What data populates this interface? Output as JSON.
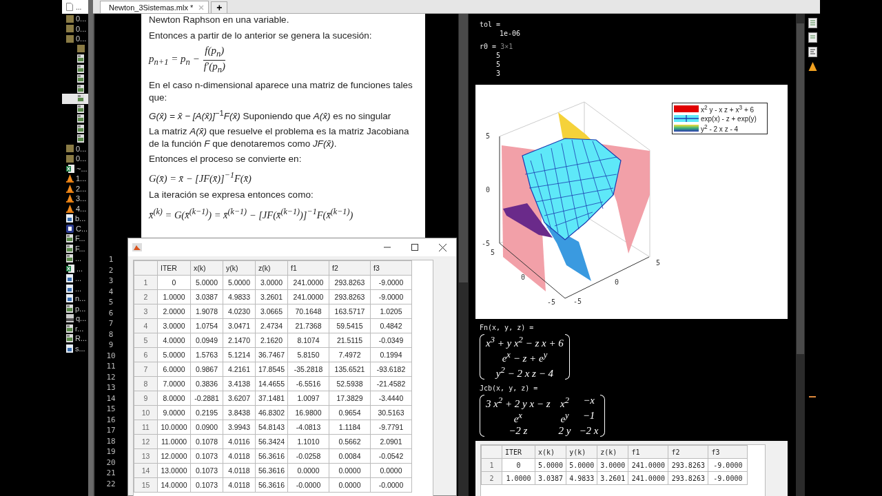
{
  "file_browser": {
    "header": "...",
    "items": [
      {
        "kind": "folder",
        "label": "0...",
        "selected": false
      },
      {
        "kind": "folder",
        "label": "0...",
        "selected": false
      },
      {
        "kind": "folder",
        "label": "0...",
        "selected": false,
        "children": [
          {
            "kind": "folder",
            "selected": false
          },
          {
            "kind": "live",
            "selected": false
          },
          {
            "kind": "live",
            "selected": false
          },
          {
            "kind": "live",
            "selected": false
          },
          {
            "kind": "live",
            "selected": false
          },
          {
            "kind": "live",
            "selected": true
          },
          {
            "kind": "live",
            "selected": false
          },
          {
            "kind": "live",
            "selected": false
          },
          {
            "kind": "live",
            "selected": false
          },
          {
            "kind": "live",
            "selected": false
          }
        ]
      },
      {
        "kind": "folder",
        "label": "0...",
        "selected": false
      },
      {
        "kind": "folder",
        "label": "0...",
        "selected": false
      },
      {
        "kind": "sheet",
        "label": "~...",
        "selected": false
      },
      {
        "kind": "cone",
        "label": "1...",
        "selected": false
      },
      {
        "kind": "cone",
        "label": "2...",
        "selected": false
      },
      {
        "kind": "cone",
        "label": "3...",
        "selected": false
      },
      {
        "kind": "cone",
        "label": "4...",
        "selected": false
      },
      {
        "kind": "image",
        "label": "b...",
        "selected": false
      },
      {
        "kind": "app",
        "label": "C...",
        "selected": false
      },
      {
        "kind": "live",
        "label": "F...",
        "selected": false
      },
      {
        "kind": "live",
        "label": "F...",
        "selected": false
      },
      {
        "kind": "live",
        "label": "...",
        "selected": false
      },
      {
        "kind": "sheet",
        "label": "...",
        "selected": false
      },
      {
        "kind": "image",
        "label": "...",
        "selected": false
      },
      {
        "kind": "image",
        "label": "...",
        "selected": false
      },
      {
        "kind": "image",
        "label": "n...",
        "selected": false
      },
      {
        "kind": "live",
        "label": "p...",
        "selected": false
      },
      {
        "kind": "ps",
        "label": "q...",
        "selected": false
      },
      {
        "kind": "live",
        "label": "r...",
        "selected": false
      },
      {
        "kind": "live",
        "label": "R...",
        "selected": false
      },
      {
        "kind": "image",
        "label": "s...",
        "selected": false
      }
    ]
  },
  "tabs": [
    {
      "label": "Newton_3Sistemas.mlx *",
      "selected": true
    }
  ],
  "new_tab": "+",
  "document": [
    {
      "kind": "text",
      "text": "Newton Raphson en una variable."
    },
    {
      "kind": "text",
      "text": "Entonces a partir de lo anterior se genera la sucesión:"
    },
    {
      "kind": "fraction",
      "lhs": "p$_{n+1}$ = p$_{n}$ −",
      "numerator": "f(p$_{n}$)",
      "denominator": "f′(p$_{n}$)"
    },
    {
      "kind": "text",
      "text": "En el caso n-dimensional aparece una matriz de funciones tales que:"
    },
    {
      "kind": "text",
      "text": "*G(x̄) = x̄ − [A(x̄)]*$^{−1}$*F(x̄)* Suponiendo que *A(x̄)* es no singular"
    },
    {
      "kind": "text",
      "text": "La matriz *A(x̄)* que resuelve el problema es la matriz Jacobiana de la función *F* que denotaremos como *JF(x̄)*."
    },
    {
      "kind": "text",
      "text": "Entonces el proceso se convierte en:"
    },
    {
      "kind": "math",
      "text": "G(x̄) = x̄ − [JF(x̄)]$^{−1}$F(x̄)"
    },
    {
      "kind": "text",
      "text": "La iteración se expresa entonces como:"
    },
    {
      "kind": "math",
      "text": "x̄$^{(k)}$ = G(x̄$^{(k−1)}$) = x̄$^{(k−1)}$ − [JF(x̄$^{(k−1)}$)]$^{−1}$F(x̄$^{(k−1)}$)"
    }
  ],
  "line_numbers": [
    "1",
    "2",
    "3",
    "4",
    "5",
    "6",
    "7",
    "8",
    "9",
    "10",
    "11",
    "12",
    "13",
    "14",
    "15",
    "16",
    "17",
    "18",
    "19",
    "20",
    "21",
    "22"
  ],
  "figure_window": {
    "table": {
      "columns": [
        "",
        "ITER",
        "x(k)",
        "y(k)",
        "z(k)",
        "f1",
        "f2",
        "f3"
      ],
      "rows": [
        [
          "1",
          "0",
          "5.0000",
          "5.0000",
          "3.0000",
          "241.0000",
          "293.8263",
          "-9.0000"
        ],
        [
          "2",
          "1.0000",
          "3.0387",
          "4.9833",
          "3.2601",
          "241.0000",
          "293.8263",
          "-9.0000"
        ],
        [
          "3",
          "2.0000",
          "1.9078",
          "4.0230",
          "3.0665",
          "70.1648",
          "163.5717",
          "1.0205"
        ],
        [
          "4",
          "3.0000",
          "1.0754",
          "3.0471",
          "2.4734",
          "21.7368",
          "59.5415",
          "0.4842"
        ],
        [
          "5",
          "4.0000",
          "0.0949",
          "2.1470",
          "2.1620",
          "8.1074",
          "21.5115",
          "-0.0349"
        ],
        [
          "6",
          "5.0000",
          "1.5763",
          "5.1214",
          "36.7467",
          "5.8150",
          "7.4972",
          "0.1994"
        ],
        [
          "7",
          "6.0000",
          "0.9867",
          "4.2161",
          "17.8545",
          "-35.2818",
          "135.6521",
          "-93.6182"
        ],
        [
          "8",
          "7.0000",
          "0.3836",
          "3.4138",
          "14.4655",
          "-6.5516",
          "52.5938",
          "-21.4582"
        ],
        [
          "9",
          "8.0000",
          "-0.2881",
          "3.6207",
          "37.1481",
          "1.0097",
          "17.3829",
          "-3.4440"
        ],
        [
          "10",
          "9.0000",
          "0.2195",
          "3.8438",
          "46.8302",
          "16.9800",
          "0.9654",
          "30.5163"
        ],
        [
          "11",
          "10.0000",
          "0.0900",
          "3.9943",
          "54.8143",
          "-4.0813",
          "1.1184",
          "-9.7791"
        ],
        [
          "12",
          "11.0000",
          "0.1078",
          "4.0116",
          "56.3424",
          "1.1010",
          "0.5662",
          "2.0901"
        ],
        [
          "13",
          "12.0000",
          "0.1073",
          "4.0118",
          "56.3616",
          "-0.0258",
          "0.0084",
          "-0.0542"
        ],
        [
          "14",
          "13.0000",
          "0.1073",
          "4.0118",
          "56.3616",
          "0.0000",
          "0.0000",
          "0.0000"
        ],
        [
          "15",
          "14.0000",
          "0.1073",
          "4.0118",
          "56.3616",
          "-0.0000",
          "0.0000",
          "-0.0000"
        ]
      ]
    }
  },
  "output": [
    {
      "kind": "variable",
      "name": "tol =",
      "values": [
        "1e-06"
      ]
    },
    {
      "kind": "variable",
      "name": "r0 =",
      "size": "3×1",
      "values": [
        "5",
        "5",
        "3"
      ]
    },
    {
      "kind": "plot",
      "z_ticks": [
        "5",
        "0",
        "-5"
      ],
      "x_ticks": [
        "5",
        "0",
        "-5"
      ],
      "y_ticks": [
        "-5",
        "0",
        "5"
      ],
      "legend": [
        {
          "kind": "solid",
          "label": "x$^{2}$ y - x z + x$^{3}$ + 6"
        },
        {
          "kind": "mesh",
          "label": "exp(x) - z + exp(y)"
        },
        {
          "kind": "gradient",
          "label": "y$^{2}$ - 2 x z - 4"
        }
      ]
    },
    {
      "kind": "matrix",
      "name": "Fn(x, y, z) =",
      "rows": [
        [
          "x$^{3}$ + y x$^{2}$ − z x + 6"
        ],
        [
          "e$^{x}$ − z + e$^{y}$"
        ],
        [
          "y$^{2}$ − 2 x z − 4"
        ]
      ]
    },
    {
      "kind": "matrix",
      "name": "Jcb(x, y, z) =",
      "rows": [
        [
          "3 x$^{2}$ + 2 y x − z",
          "x$^{2}$",
          "−x"
        ],
        [
          "e$^{x}$",
          "e$^{y}$",
          "−1"
        ],
        [
          "−2 z",
          "2 y",
          "−2 x"
        ]
      ]
    },
    {
      "kind": "table",
      "columns": [
        "",
        "ITER",
        "x(k)",
        "y(k)",
        "z(k)",
        "f1",
        "f2",
        "f3"
      ],
      "rows": [
        [
          "1",
          "0",
          "5.0000",
          "5.0000",
          "3.0000",
          "241.0000",
          "293.8263",
          "-9.0000"
        ],
        [
          "2",
          "1.0000",
          "3.0387",
          "4.9833",
          "3.2601",
          "241.0000",
          "293.8263",
          "-9.0000"
        ]
      ]
    }
  ]
}
